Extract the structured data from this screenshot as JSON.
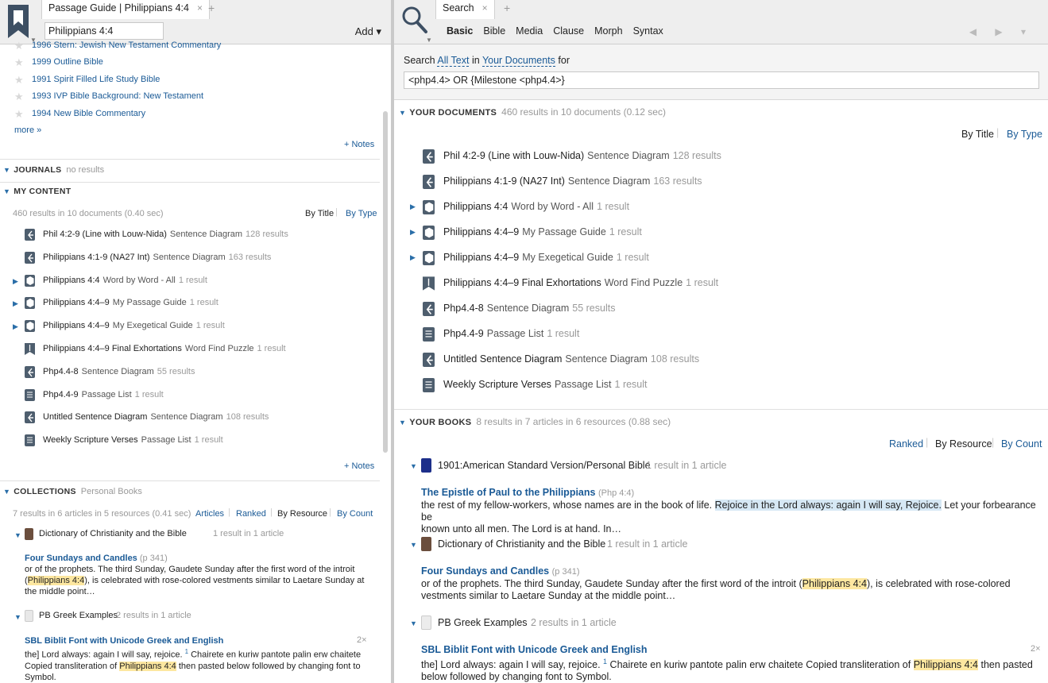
{
  "left": {
    "tab_title": "Passage Guide | Philippians 4:4",
    "tab_close": "×",
    "tab_plus": "+",
    "reference_value": "Philippians 4:4",
    "add_label": "Add ▾",
    "commentaries": [
      {
        "label": "1996 Stern: Jewish New Testament Commentary"
      },
      {
        "label": "1999 Outline Bible"
      },
      {
        "label": "1991 Spirit Filled Life Study Bible"
      },
      {
        "label": "1993 IVP Bible Background: New Testament"
      },
      {
        "label": "1994 New Bible Commentary"
      }
    ],
    "more_label": "more »",
    "notes_label": "+ Notes",
    "journals": {
      "title": "JOURNALS",
      "status": "no results"
    },
    "my_content": {
      "title": "MY CONTENT",
      "summary": "460 results in 10 documents (0.40 sec)",
      "by_title": "By Title",
      "by_type": "By Type",
      "items": [
        {
          "title": "Phil 4:2-9 (Line with Louw-Nida)",
          "type": "Sentence Diagram",
          "count": "128 results",
          "icon": "diagram-icon"
        },
        {
          "title": "Philippians 4:1-9 (NA27 Int)",
          "type": "Sentence Diagram",
          "count": "163 results",
          "icon": "diagram-icon"
        },
        {
          "title": "Philippians 4:4",
          "type": "Word by Word - All",
          "count": "1 result",
          "icon": "guide-icon"
        },
        {
          "title": "Philippians 4:4–9",
          "type": "My Passage Guide",
          "count": "1 result",
          "icon": "guide-icon"
        },
        {
          "title": "Philippians 4:4–9",
          "type": "My Exegetical Guide",
          "count": "1 result",
          "icon": "guide-icon"
        },
        {
          "title": "Philippians 4:4–9 Final Exhortations",
          "type": "Word Find Puzzle",
          "count": "1 result",
          "icon": "puzzle-icon"
        },
        {
          "title": "Php4.4-8",
          "type": "Sentence Diagram",
          "count": "55 results",
          "icon": "diagram-icon"
        },
        {
          "title": "Php4.4-9",
          "type": "Passage List",
          "count": "1 result",
          "icon": "list-icon"
        },
        {
          "title": "Untitled Sentence Diagram",
          "type": "Sentence Diagram",
          "count": "108 results",
          "icon": "diagram-icon"
        },
        {
          "title": "Weekly Scripture Verses",
          "type": "Passage List",
          "count": "1 result",
          "icon": "list-icon"
        }
      ]
    },
    "collections": {
      "title": "COLLECTIONS",
      "collection_name": "Personal Books",
      "summary": "7 results in 6 articles in 5 resources (0.41 sec)",
      "opt_articles": "Articles",
      "opt_ranked": "Ranked",
      "opt_by_resource": "By Resource",
      "opt_by_count": "By Count",
      "dict": {
        "title": "Dictionary of Christianity and the Bible",
        "count": "1 result in 1 article"
      },
      "dict_article": {
        "title": "Four Sundays and Candles",
        "page": "(p 341)",
        "l1": "or of the prophets. The third Sunday, Gaudete Sunday after the first word of the introit",
        "l2a": "(",
        "l2hl": "Philippians 4:4",
        "l2b": "), is celebrated with rose-colored vestments similar to Laetare Sunday at",
        "l3": "the middle point…"
      },
      "pbg": {
        "title": "PB Greek Examples",
        "count": "2 results in 1 article"
      },
      "pbg_article": {
        "title": "SBL Biblit Font with Unicode Greek and English",
        "mult": "2×",
        "l1a": "the] Lord always: again I will say, rejoice. ",
        "l1sup": "1",
        "l1b": " Chairete en kuriw pantote palin erw chaitete",
        "l2a": "Copied transliteration of ",
        "l2hl": "Philippians 4:4",
        "l2b": " then pasted below followed by changing font to",
        "l3": "Symbol."
      }
    }
  },
  "right": {
    "tab_title": "Search",
    "tab_close": "×",
    "tab_plus": "+",
    "subtabs": [
      "Basic",
      "Bible",
      "Media",
      "Clause",
      "Morph",
      "Syntax"
    ],
    "nav_arrows": "◀ ▶ ▾",
    "search_word": "Search",
    "scope_text": "All Text",
    "in_word": "in",
    "scope_docs": "Your Documents",
    "for_word": "for",
    "query": "<php4.4> OR {Milestone <php4.4>}",
    "your_docs": {
      "title": "YOUR DOCUMENTS",
      "summary": "460 results in 10 documents (0.12 sec)",
      "by_title": "By Title",
      "by_type": "By Type",
      "items": [
        {
          "title": "Phil 4:2-9 (Line with Louw-Nida)",
          "type": "Sentence Diagram",
          "count": "128 results"
        },
        {
          "title": "Philippians 4:1-9 (NA27 Int)",
          "type": "Sentence Diagram",
          "count": "163 results"
        },
        {
          "title": "Philippians 4:4",
          "type": "Word by Word - All",
          "count": "1 result"
        },
        {
          "title": "Philippians 4:4–9",
          "type": "My Passage Guide",
          "count": "1 result"
        },
        {
          "title": "Philippians 4:4–9",
          "type": "My Exegetical Guide",
          "count": "1 result"
        },
        {
          "title": "Philippians 4:4–9 Final Exhortations",
          "type": "Word Find Puzzle",
          "count": "1 result"
        },
        {
          "title": "Php4.4-8",
          "type": "Sentence Diagram",
          "count": "55 results"
        },
        {
          "title": "Php4.4-9",
          "type": "Passage List",
          "count": "1 result"
        },
        {
          "title": "Untitled Sentence Diagram",
          "type": "Sentence Diagram",
          "count": "108 results"
        },
        {
          "title": "Weekly Scripture Verses",
          "type": "Passage List",
          "count": "1 result"
        }
      ]
    },
    "your_books": {
      "title": "YOUR BOOKS",
      "summary": "8 results in 7 articles in 6 resources (0.88 sec)",
      "opt_ranked": "Ranked",
      "opt_by_resource": "By Resource",
      "opt_by_count": "By Count",
      "asv": {
        "title": "1901:American Standard Version/Personal Bible",
        "count": "1 result in 1 article"
      },
      "asv_article": {
        "title": "The Epistle of Paul to the Philippians",
        "ref": "(Php 4:4)",
        "l1a": "the rest of my fellow-workers, whose names are in the book of life. ",
        "l1hl": "Rejoice in the Lord always: again I will say, Rejoice.",
        "l1b": " Let your forbearance be",
        "l2": "known unto all men. The Lord is at hand. In…"
      },
      "dict": {
        "title": "Dictionary of Christianity and the Bible",
        "count": "1 result in 1 article"
      },
      "dict_article": {
        "title": "Four Sundays and Candles",
        "page": "(p 341)",
        "l1a": "or of the prophets. The third Sunday, Gaudete Sunday after the first word of the introit (",
        "l1hl": "Philippians 4:4",
        "l1b": "), is celebrated with rose-colored",
        "l2": "vestments similar to Laetare Sunday at the middle point…"
      },
      "pbg": {
        "title": "PB Greek Examples",
        "count": "2 results in 1 article"
      },
      "pbg_article": {
        "title": "SBL Biblit Font with Unicode Greek and English",
        "mult": "2×",
        "l1a": "the] Lord always: again I will say, rejoice. ",
        "l1sup": "1",
        "l1b": " Chairete en kuriw pantote palin erw chaitete Copied transliteration of ",
        "l1hl": "Philippians 4:4",
        "l1c": " then pasted",
        "l2": "below followed by changing font to Symbol."
      }
    }
  }
}
